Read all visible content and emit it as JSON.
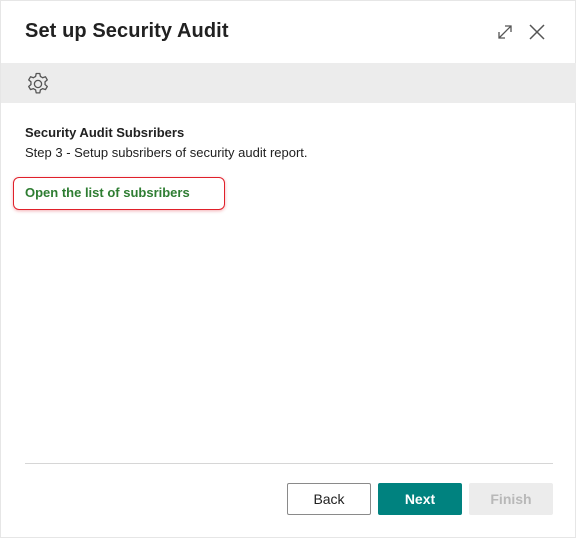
{
  "dialog": {
    "title": "Set up Security Audit"
  },
  "window_controls": {
    "expand_icon": "expand-icon",
    "close_icon": "close-icon"
  },
  "action_bar": {
    "icon": "gear-icon"
  },
  "content": {
    "heading": "Security Audit Subsribers",
    "step_text": "Step 3 - Setup subsribers of security audit report.",
    "link_text": "Open the list of subsribers"
  },
  "footer": {
    "back_label": "Back",
    "next_label": "Next",
    "finish_label": "Finish",
    "finish_enabled": false
  },
  "colors": {
    "accent": "#00827f",
    "link": "#2e7d32",
    "highlight_border": "#e0202a",
    "action_bar_bg": "#ececec"
  }
}
